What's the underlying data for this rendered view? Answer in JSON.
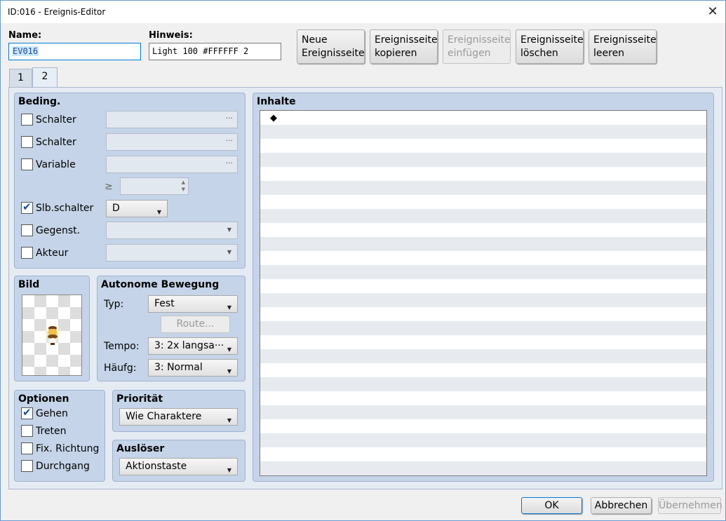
{
  "window": {
    "title": "ID:016 - Ereignis-Editor"
  },
  "fields": {
    "name_label": "Name:",
    "name_value": "EV016",
    "note_label": "Hinweis:",
    "note_value": "Light 100 #FFFFFF 2"
  },
  "page_buttons": {
    "new": "Neue\nEreignisseite",
    "copy": "Ereignisseite\nkopieren",
    "paste": "Ereignisseite\neinfügen",
    "delete": "Ereignisseite\nlöschen",
    "clear": "Ereignisseite\nleeren"
  },
  "tabs": [
    {
      "label": "1"
    },
    {
      "label": "2",
      "active": true
    }
  ],
  "conditions": {
    "title": "Beding.",
    "switch1_label": "Schalter",
    "switch2_label": "Schalter",
    "variable_label": "Variable",
    "gte_symbol": "≥",
    "self_switch_label": "Slb.schalter",
    "self_switch_value": "D",
    "self_switch_checked": true,
    "item_label": "Gegenst.",
    "actor_label": "Akteur",
    "dots": "···"
  },
  "image": {
    "title": "Bild"
  },
  "movement": {
    "title": "Autonome Bewegung",
    "type_label": "Typ:",
    "type_value": "Fest",
    "route_button": "Route...",
    "speed_label": "Tempo:",
    "speed_value": "3: 2x langsa···",
    "freq_label": "Häufg:",
    "freq_value": "3: Normal"
  },
  "options": {
    "title": "Optionen",
    "walk_label": "Gehen",
    "walk_checked": true,
    "step_label": "Treten",
    "dirfix_label": "Fix. Richtung",
    "through_label": "Durchgang"
  },
  "priority": {
    "title": "Priorität",
    "value": "Wie Charaktere"
  },
  "trigger": {
    "title": "Auslöser",
    "value": "Aktionstaste"
  },
  "contents": {
    "title": "Inhalte",
    "first_row_marker": "◆"
  },
  "footer": {
    "ok": "OK",
    "cancel": "Abbrechen",
    "apply": "Übernehmen"
  },
  "colors": {
    "group_bg": "#c5d4e8",
    "panel_bg": "#e5ebf3",
    "accent": "#0078d7"
  }
}
